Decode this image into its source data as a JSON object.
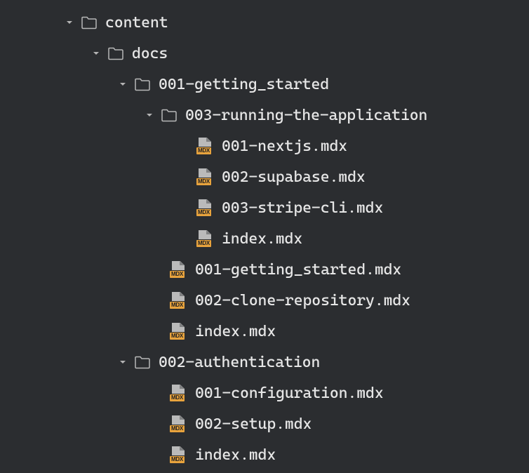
{
  "tree": [
    {
      "type": "folder",
      "label": "content",
      "indent": 90,
      "expanded": true
    },
    {
      "type": "folder",
      "label": "docs",
      "indent": 128,
      "expanded": true
    },
    {
      "type": "folder",
      "label": "001-getting_started",
      "indent": 166,
      "expanded": true
    },
    {
      "type": "folder",
      "label": "003-running-the-application",
      "indent": 204,
      "expanded": true
    },
    {
      "type": "file",
      "label": "001-nextjs.mdx",
      "indent": 280
    },
    {
      "type": "file",
      "label": "002-supabase.mdx",
      "indent": 280
    },
    {
      "type": "file",
      "label": "003-stripe-cli.mdx",
      "indent": 280
    },
    {
      "type": "file",
      "label": "index.mdx",
      "indent": 280
    },
    {
      "type": "file",
      "label": "001-getting_started.mdx",
      "indent": 242
    },
    {
      "type": "file",
      "label": "002-clone-repository.mdx",
      "indent": 242
    },
    {
      "type": "file",
      "label": "index.mdx",
      "indent": 242
    },
    {
      "type": "folder",
      "label": "002-authentication",
      "indent": 166,
      "expanded": true
    },
    {
      "type": "file",
      "label": "001-configuration.mdx",
      "indent": 242
    },
    {
      "type": "file",
      "label": "002-setup.mdx",
      "indent": 242
    },
    {
      "type": "file",
      "label": "index.mdx",
      "indent": 242
    }
  ]
}
